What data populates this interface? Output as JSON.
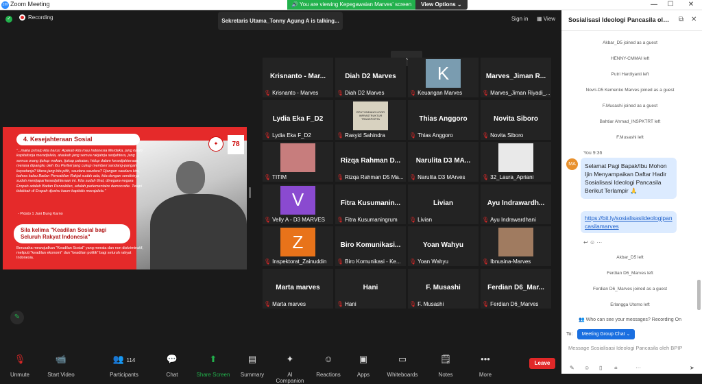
{
  "app": {
    "title": "Zoom Meeting",
    "logo": "zm"
  },
  "window_controls": {
    "minimize": "—",
    "maximize": "☐",
    "restore": "⧉",
    "close": "✕"
  },
  "share_banner": {
    "text": "You are viewing Kepegawaian Marves' screen",
    "view_options": "View Options"
  },
  "top": {
    "recording": "Recording",
    "talking": "Sekretaris Utama_Tonny Agung A is talking...",
    "sign_in": "Sign in",
    "view": "View"
  },
  "slide": {
    "title": "4. Kesejahteraan Sosial",
    "quote": "\"...maka prinsip kita harus: Apakah kita mau Indonesia Merdeka, jang kaum kapitalisnja meradjalela, ataukah jang semua rakjatnja sedjahtera, jang semua orang tjukup makan, tjukup pakaian, hidup dalam kesedjahteraan, merasa dipangku oleh Ibu Pertiwi jang cukup memberi sandang-pangan kepadanja? Mana jang kita pilih, saudara-saudara? Djangan saudara kira, bahwa kalau Badan Perwakilan Rakjat sudah ada, kita dengan sendirinya sudah mentjapai kesedjahteraan ini. Kita sudah lihat, dinegara-negara Eropah adalah Badan Perwakilan, adalah parlementaire democratie. Tetapi tidakkah di Eropah djustru kaum kapitalis merajalela.\"",
    "source": "- Pidato 1 Juni Bung Karno",
    "subtitle": "Sila kelima \"Keadilan Sosial bagi Seluruh Rakyat Indonesia\"",
    "body": "Berusaha mewujudkan \"Keadilan Sosial\" yang merata dan non diskriminatif, meliputi \"keadilan ekonomi\" dan \"keadilan politik\" bagi seluruh rakyat Indonesia.",
    "logo_text": "78"
  },
  "participants": [
    {
      "name": "Krisnanto - Mar...",
      "label": "Krisnanto - Marves",
      "avatar": ""
    },
    {
      "name": "Diah D2 Marves",
      "label": "Diah D2 Marves",
      "avatar": ""
    },
    {
      "name": "",
      "label": "Keuangan Marves",
      "avatar": "K"
    },
    {
      "name": "Marves_Jiman R...",
      "label": "Marves_Jiman Riyadi_...",
      "avatar": ""
    },
    {
      "name": "Lydia Eka F_D2",
      "label": "Lydia Eka F_D2",
      "avatar": ""
    },
    {
      "name": "",
      "label": "Rasyid Sahindra",
      "avatar": ""
    },
    {
      "name": "Thias Anggoro",
      "label": "Thias Anggoro",
      "avatar": ""
    },
    {
      "name": "Novita Siboro",
      "label": "Novita Siboro",
      "avatar": ""
    },
    {
      "name": "",
      "label": "TITIM",
      "avatar": ""
    },
    {
      "name": "Rizqa Rahman D...",
      "label": "Rizqa Rahman D5 Ma...",
      "avatar": ""
    },
    {
      "name": "Narulita D3 MA...",
      "label": "Narulita D3 MArves",
      "avatar": ""
    },
    {
      "name": "",
      "label": "32_Laura_Apriani",
      "avatar": ""
    },
    {
      "name": "",
      "label": "Velly A - D3 MARVES",
      "avatar": "V"
    },
    {
      "name": "Fitra Kusumanin...",
      "label": "Fitra Kusumaningrum",
      "avatar": ""
    },
    {
      "name": "Livian",
      "label": "Livian",
      "avatar": ""
    },
    {
      "name": "Ayu Indrawardh...",
      "label": "Ayu Indrawardhani",
      "avatar": ""
    },
    {
      "name": "",
      "label": "Inspektorat_Zainuddin",
      "avatar": "Z"
    },
    {
      "name": "Biro Komunikasi...",
      "label": "Biro Komunikasi - Ke...",
      "avatar": ""
    },
    {
      "name": "Yoan Wahyu",
      "label": "Yoan Wahyu",
      "avatar": ""
    },
    {
      "name": "",
      "label": "Ibnusina-Marves",
      "avatar": ""
    },
    {
      "name": "Marta marves",
      "label": "Marta marves",
      "avatar": ""
    },
    {
      "name": "Hani",
      "label": "Hani",
      "avatar": ""
    },
    {
      "name": "F. Musashi",
      "label": "F. Musashi",
      "avatar": ""
    },
    {
      "name": "Ferdian D6_Mar...",
      "label": "Ferdian D6_Marves",
      "avatar": ""
    }
  ],
  "thumb_text": {
    "rasyid": "RPUTI BIDANG KOOR INFRASTRUKTUR TRANSPORTA"
  },
  "toolbar": {
    "unmute": "Unmute",
    "start_video": "Start Video",
    "participants": "Participants",
    "participants_count": "114",
    "chat": "Chat",
    "share": "Share Screen",
    "summary": "Summary",
    "ai": "AI Companion",
    "reactions": "Reactions",
    "apps": "Apps",
    "whiteboards": "Whiteboards",
    "notes": "Notes",
    "more": "More",
    "leave": "Leave"
  },
  "chat": {
    "title": "Sosialisasi Ideologi Pancasila oleh B...",
    "system_top": [
      "Akbar_D5 joined as a guest",
      "HENNY-CMMAI left",
      "Putri Hardiyanti left",
      "Novri-D5 Kemenko Marves joined as a guest",
      "F.Musashi joined as a guest",
      "Bahtiar Ahmad_INSPKTRT left",
      "F.Musashi left"
    ],
    "you_label": "You 9:36",
    "avatar": "MA",
    "message": "Selamat Pagi Bapak/Ibu Mohon Ijin Menyampaikan Daftar Hadir Sosialisasi Ideologi Pancasila Berikut Terlampir 🙏",
    "link": "https://bit.ly/sosialisasiideologipancasilamarves",
    "system_bottom": [
      "Akbar_D5 left",
      "Ferdian D6_Marves left",
      "Ferdian D6_Marves joined as a guest",
      "Erlangga Utomo left"
    ],
    "who_can_see": "Who can see your messages? Recording On",
    "to": "To:",
    "to_value": "Meeting Group Chat",
    "placeholder": "Message Sosialisasi Ideologi Pancasila oleh BPIP"
  },
  "colors": {
    "zoom_blue": "#2d8cff",
    "banner_green": "#22b14c",
    "leave_red": "#e02828",
    "slide_red": "#e52a2a",
    "bubble": "#dcebff"
  }
}
